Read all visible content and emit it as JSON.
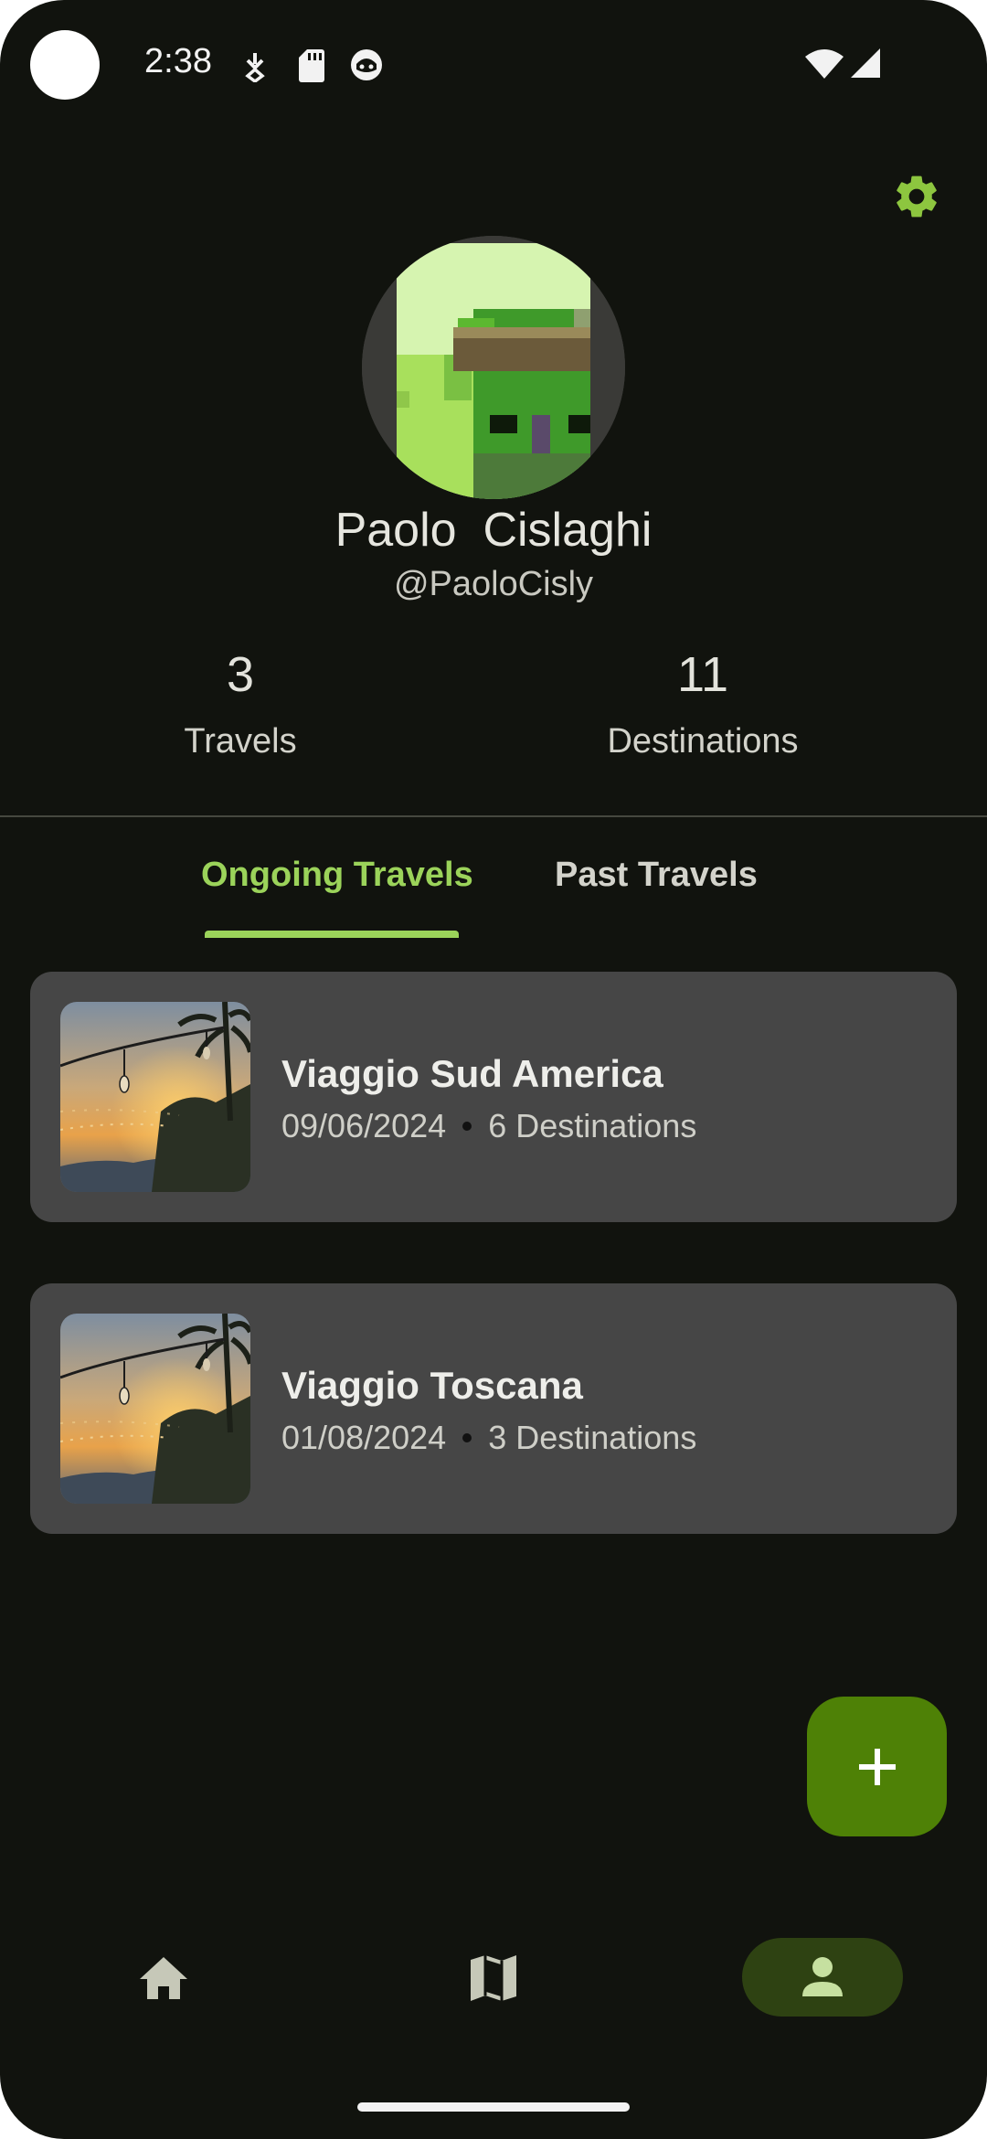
{
  "status_bar": {
    "time": "2:38"
  },
  "profile": {
    "name": "Paolo  Cislaghi",
    "handle": "@PaoloCisly"
  },
  "stats": {
    "travels": {
      "value": "3",
      "label": "Travels"
    },
    "destinations": {
      "value": "11",
      "label": "Destinations"
    }
  },
  "tabs": [
    {
      "label": "Ongoing Travels",
      "selected": true
    },
    {
      "label": "Past Travels",
      "selected": false
    }
  ],
  "travels": [
    {
      "title": "Viaggio Sud America",
      "date": "09/06/2024",
      "destinations": "6 Destinations"
    },
    {
      "title": "Viaggio Toscana",
      "date": "01/08/2024",
      "destinations": "3 Destinations"
    }
  ],
  "fab": {
    "icon": "plus-icon"
  },
  "bottom_nav": [
    {
      "icon": "home-icon",
      "selected": false
    },
    {
      "icon": "map-icon",
      "selected": false
    },
    {
      "icon": "person-icon",
      "selected": true
    }
  ],
  "colors": {
    "background": "#11130e",
    "accent": "#9bd35a",
    "fab": "#4e8106",
    "card": "#464646",
    "nav_selected": "#2e4212"
  }
}
